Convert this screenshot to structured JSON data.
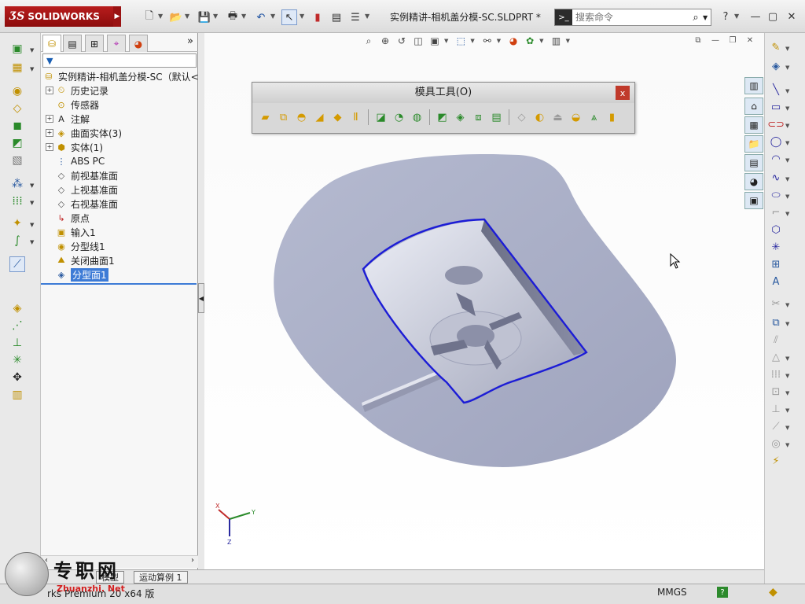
{
  "app": {
    "brand": "SOLIDWORKS",
    "doc_title": "实例精讲-相机盖分模-SC.SLDPRT *"
  },
  "search": {
    "placeholder": "搜索命令"
  },
  "feature_tree": {
    "root_label": "实例精讲-相机盖分模-SC（默认<",
    "items": [
      {
        "label": "历史记录",
        "expandable": true,
        "icon": "history-icon"
      },
      {
        "label": "传感器",
        "expandable": false,
        "icon": "sensor-icon"
      },
      {
        "label": "注解",
        "expandable": true,
        "icon": "annotation-icon"
      },
      {
        "label": "曲面实体(3)",
        "expandable": true,
        "icon": "surface-bodies-icon"
      },
      {
        "label": "实体(1)",
        "expandable": true,
        "icon": "solid-bodies-icon"
      },
      {
        "label": "ABS PC",
        "expandable": false,
        "icon": "material-icon"
      },
      {
        "label": "前视基准面",
        "expandable": false,
        "icon": "plane-icon"
      },
      {
        "label": "上视基准面",
        "expandable": false,
        "icon": "plane-icon"
      },
      {
        "label": "右视基准面",
        "expandable": false,
        "icon": "plane-icon"
      },
      {
        "label": "原点",
        "expandable": false,
        "icon": "origin-icon"
      },
      {
        "label": "输入1",
        "expandable": false,
        "icon": "import-icon"
      },
      {
        "label": "分型线1",
        "expandable": false,
        "icon": "parting-line-icon"
      },
      {
        "label": "关闭曲面1",
        "expandable": false,
        "icon": "shut-off-surface-icon"
      },
      {
        "label": "分型面1",
        "expandable": false,
        "icon": "parting-surface-icon",
        "selected": true
      }
    ]
  },
  "mold_toolbar": {
    "title": "模具工具(O)",
    "close": "x"
  },
  "bottom_tabs": [
    {
      "label": "模型"
    },
    {
      "label": "运动算例 1"
    }
  ],
  "status": {
    "text": "rks Premium 20    x64 版",
    "units": "MMGS",
    "help": "?"
  },
  "watermark": {
    "title": "专职网",
    "subtitle": "Zhuanzhi. Net"
  },
  "axes": {
    "x": "X",
    "y": "Y",
    "z": "Z"
  },
  "colors": {
    "part": "#a9aec8",
    "parting_line": "#1c1cd6",
    "selection": "#3d7bd6",
    "brand_red": "#b81d1d"
  }
}
